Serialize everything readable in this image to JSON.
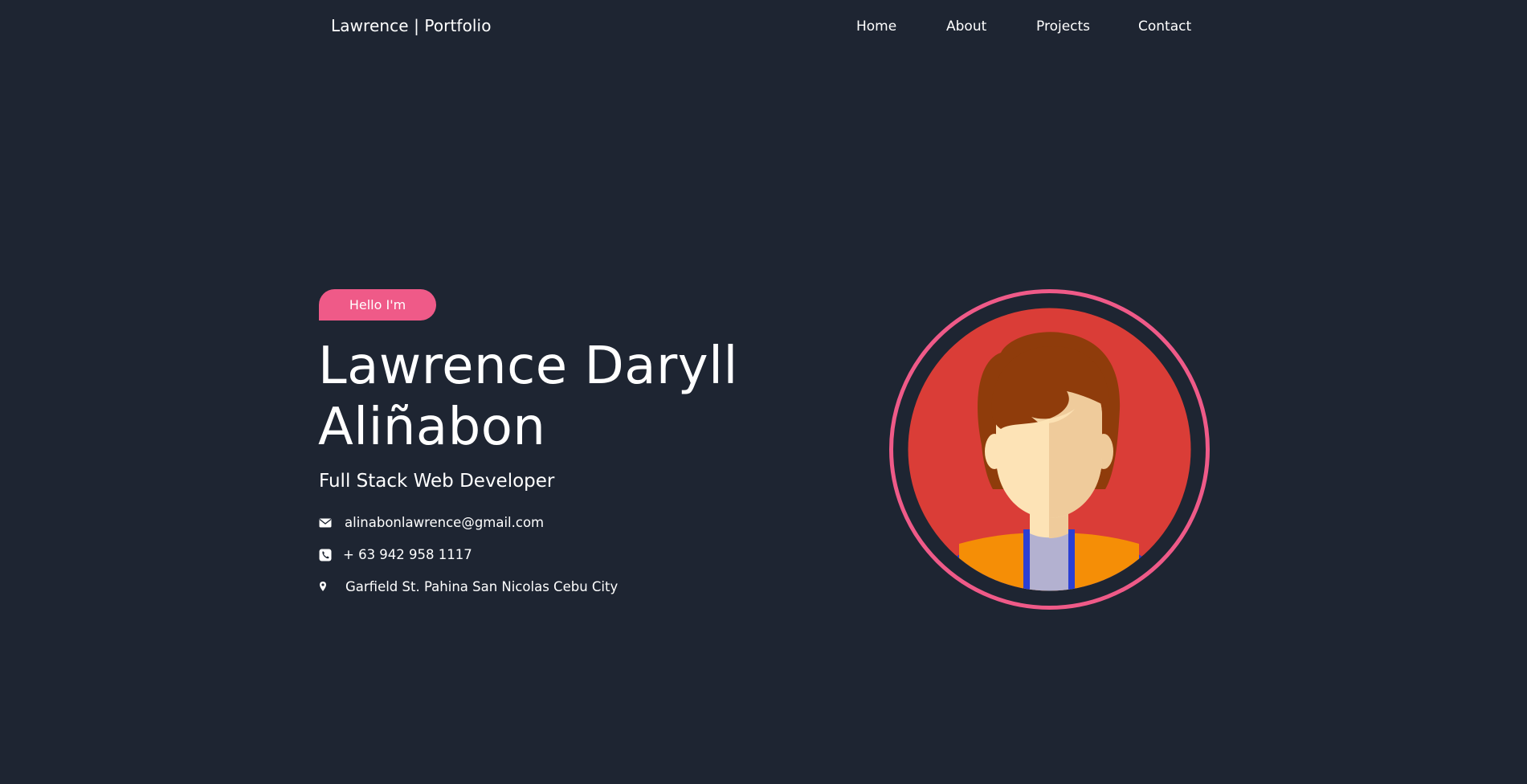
{
  "nav": {
    "brand": "Lawrence | Portfolio",
    "links": [
      {
        "label": "Home"
      },
      {
        "label": "About"
      },
      {
        "label": "Projects"
      },
      {
        "label": "Contact"
      }
    ]
  },
  "hero": {
    "greeting": "Hello I'm",
    "name_line1": "Lawrence Daryll",
    "name_line2": "Aliñabon",
    "role": "Full Stack Web Developer",
    "contact": {
      "email": "alinabonlawrence@gmail.com",
      "phone": "+ 63 942 958 1117",
      "address": "Garfield St. Pahina San Nicolas Cebu City"
    },
    "icons": {
      "email": "envelope-icon",
      "phone": "phone-icon",
      "address": "map-pin-icon"
    }
  },
  "colors": {
    "background": "#1e2532",
    "accent": "#ef5a88",
    "avatar_bg": "#da3d37",
    "hair": "#8f3c0b",
    "skin": "#fde3b6",
    "shirt": "#f58e06",
    "jacket_trim": "#2b3fd4",
    "undershirt": "#b3b1d0"
  }
}
